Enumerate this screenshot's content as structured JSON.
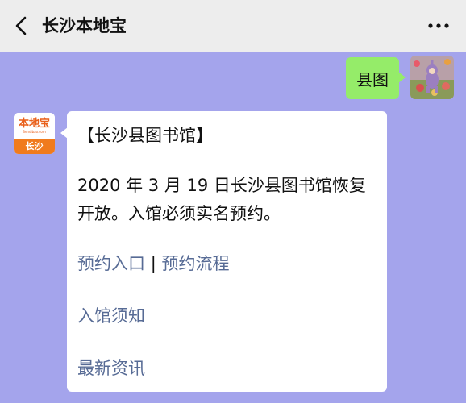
{
  "header": {
    "title": "长沙本地宝",
    "back_icon": "chevron-left-icon",
    "more_icon": "ellipsis-icon"
  },
  "outgoing": {
    "text": "县图"
  },
  "incoming": {
    "avatar": {
      "logo_text": "本地宝",
      "logo_sub": "Bendibao.com",
      "city": "长沙"
    },
    "heading": "【长沙县图书馆】",
    "body": "2020 年 3 月 19 日长沙县图书馆恢复开放。入馆必须实名预约。",
    "links": {
      "reserve_entry": "预约入口",
      "separator": "|",
      "reserve_process": "预约流程",
      "admission_notice": "入馆须知",
      "latest_news": "最新资讯"
    }
  },
  "colors": {
    "chat_background": "#a4a4ec",
    "header_background": "#ededed",
    "outgoing_bubble": "#95ec69",
    "link": "#576b95",
    "brand_orange": "#f07b1d"
  }
}
